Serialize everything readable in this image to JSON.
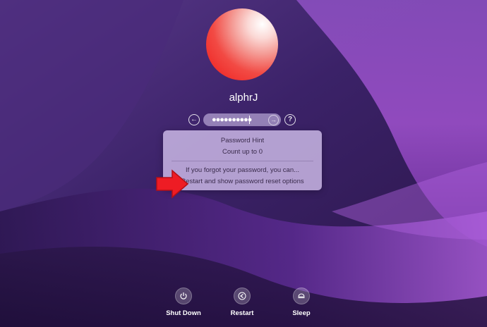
{
  "user": {
    "name": "alphrJ"
  },
  "login": {
    "password_value": "●●●●●●●●●●"
  },
  "hint_popup": {
    "title": "Password Hint",
    "hint": "Count up to 0",
    "forgot_text": "If you forgot your password, you can...",
    "reset_link": "Restart and show password reset options"
  },
  "bottom_bar": {
    "shutdown_label": "Shut Down",
    "restart_label": "Restart",
    "sleep_label": "Sleep"
  },
  "colors": {
    "annotation_arrow": "#ee1c24",
    "popup_background": "#d6c4f0",
    "avatar_red": "#ee1a1a"
  },
  "icons": {
    "back": "arrow-left-circle-icon",
    "submit": "arrow-right-circle-icon",
    "help": "question-mark-circle-icon",
    "shutdown": "power-icon",
    "restart": "restart-triangle-icon",
    "sleep": "moon-sleep-icon"
  }
}
